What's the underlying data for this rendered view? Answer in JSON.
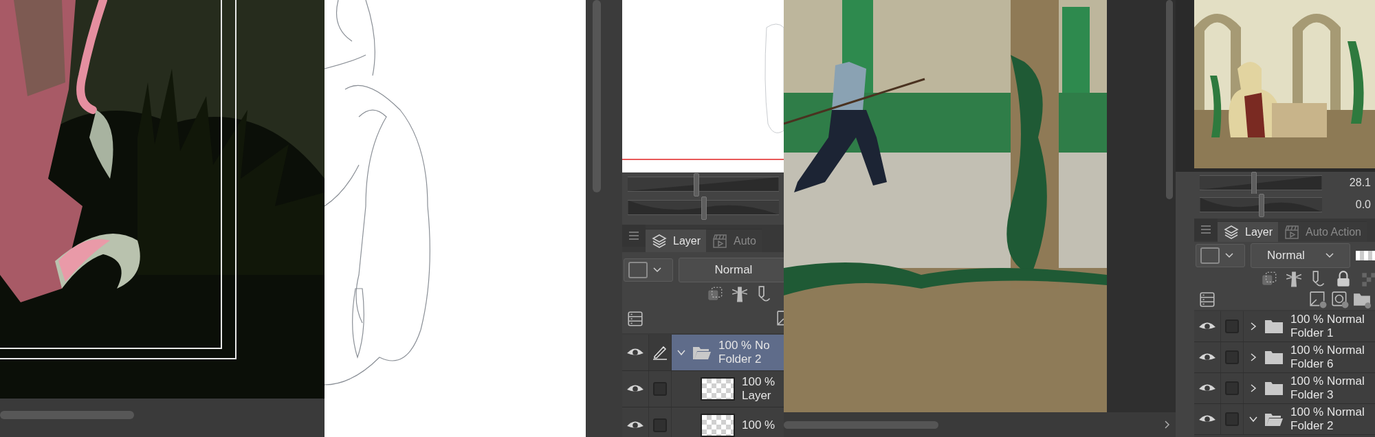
{
  "panels": [
    {
      "sliders": [
        {
          "level": 0.45
        },
        {
          "level": 0.5
        }
      ],
      "tabs": [
        {
          "label": "Layer",
          "selected": true,
          "kind": "layer"
        },
        {
          "label": "Auto",
          "selected": false,
          "kind": "action"
        }
      ],
      "blend_mode": "Normal",
      "layers": [
        {
          "kind": "folder",
          "opacity_mode": "100 % No",
          "name": "Folder 2",
          "selected": true,
          "expanded": true,
          "editing": true,
          "children": [
            {
              "kind": "layer",
              "opacity_mode": "100 %",
              "name": "Layer",
              "selected": false,
              "editing": false
            },
            {
              "kind": "layer",
              "opacity_mode": "100 %",
              "selected": false,
              "editing": false
            }
          ]
        }
      ]
    },
    {
      "sliders": [
        {
          "level": 0.44,
          "reading": "28.1"
        },
        {
          "level": 0.5,
          "reading": "0.0"
        }
      ],
      "tabs": [
        {
          "label": "Layer",
          "selected": true,
          "kind": "layer"
        },
        {
          "label": "Auto Action",
          "selected": false,
          "kind": "action"
        }
      ],
      "blend_mode": "Normal",
      "layers": [
        {
          "kind": "folder",
          "opacity_mode": "100 % Normal",
          "name": "Folder 1",
          "selected": false,
          "expanded": false,
          "editing": false
        },
        {
          "kind": "folder",
          "opacity_mode": "100 % Normal",
          "name": "Folder 6",
          "selected": false,
          "expanded": false,
          "editing": false
        },
        {
          "kind": "folder",
          "opacity_mode": "100 % Normal",
          "name": "Folder 3",
          "selected": false,
          "expanded": false,
          "editing": false
        },
        {
          "kind": "folder",
          "opacity_mode": "100 % Normal",
          "name": "Folder 2",
          "selected": false,
          "expanded": true,
          "editing": false
        }
      ]
    }
  ]
}
